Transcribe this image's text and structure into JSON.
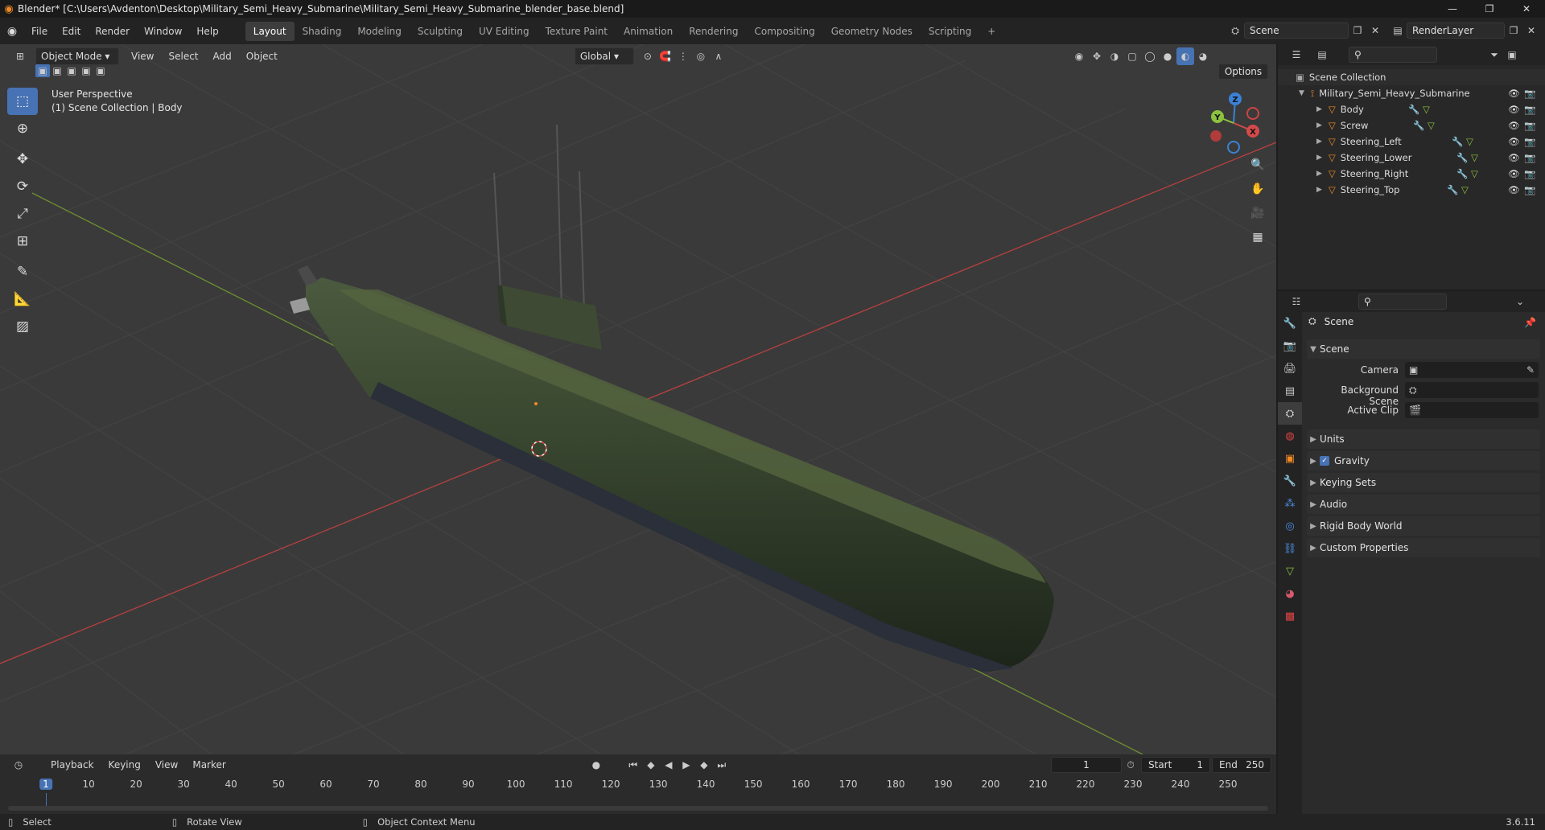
{
  "titlebar": {
    "title": "Blender* [C:\\Users\\Avdenton\\Desktop\\Military_Semi_Heavy_Submarine\\Military_Semi_Heavy_Submarine_blender_base.blend]"
  },
  "menu": [
    "File",
    "Edit",
    "Render",
    "Window",
    "Help"
  ],
  "workspaces": [
    "Layout",
    "Shading",
    "Modeling",
    "Sculpting",
    "UV Editing",
    "Texture Paint",
    "Animation",
    "Rendering",
    "Compositing",
    "Geometry Nodes",
    "Scripting"
  ],
  "scene_name": "Scene",
  "view_layer": "RenderLayer",
  "viewport": {
    "mode": "Object Mode",
    "menus": [
      "View",
      "Select",
      "Add",
      "Object"
    ],
    "orientation": "Global",
    "options": "Options",
    "perspective": "User Perspective",
    "context": "(1) Scene Collection | Body",
    "gizmo_labels": {
      "z": "Z",
      "y": "Y",
      "x": "X"
    }
  },
  "outliner": {
    "root": "Scene Collection",
    "collection": "Military_Semi_Heavy_Submarine",
    "objects": [
      "Body",
      "Screw",
      "Steering_Left",
      "Steering_Lower",
      "Steering_Right",
      "Steering_Top"
    ]
  },
  "properties": {
    "header": "Scene",
    "section_scene": "Scene",
    "labels": {
      "camera": "Camera",
      "background_scene": "Background Scene",
      "active_clip": "Active Clip"
    },
    "sections": [
      "Units",
      "Gravity",
      "Keying Sets",
      "Audio",
      "Rigid Body World",
      "Custom Properties"
    ],
    "gravity_checked": true
  },
  "timeline": {
    "menus": [
      "Playback",
      "Keying",
      "View",
      "Marker"
    ],
    "current_frame": "1",
    "start_label": "Start",
    "start": "1",
    "end_label": "End",
    "end": "250",
    "ticks": [
      "1",
      "10",
      "20",
      "30",
      "40",
      "50",
      "60",
      "70",
      "80",
      "90",
      "100",
      "110",
      "120",
      "130",
      "140",
      "150",
      "160",
      "170",
      "180",
      "190",
      "200",
      "210",
      "220",
      "230",
      "240",
      "250"
    ]
  },
  "statusbar": {
    "select": "Select",
    "rotate": "Rotate View",
    "context_menu": "Object Context Menu",
    "version": "3.6.11"
  },
  "colors": {
    "accent": "#4772b3",
    "x_axis": "#d44a4a",
    "y_axis": "#8dc23f",
    "z_axis": "#3b82d6",
    "object_icon": "#f08a24"
  }
}
